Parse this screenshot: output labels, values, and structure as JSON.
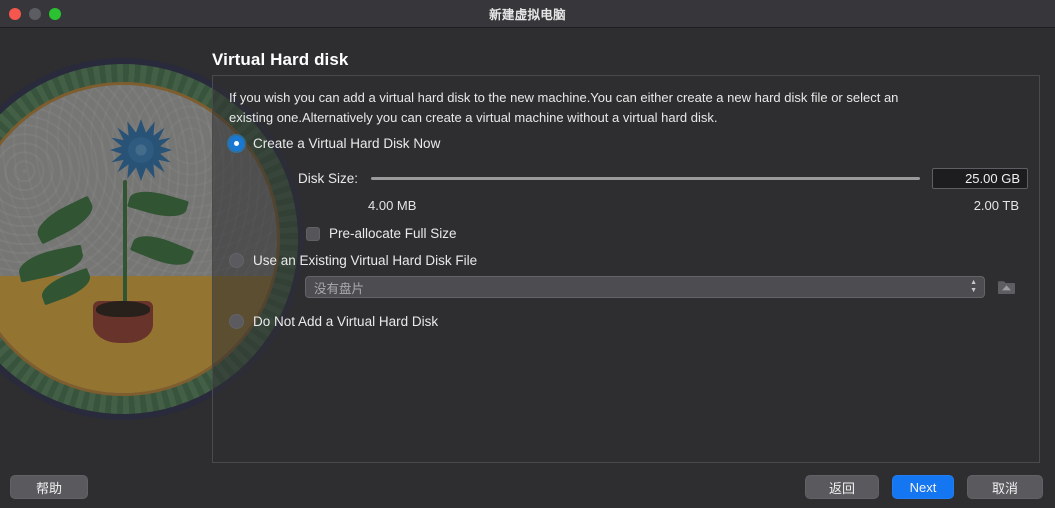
{
  "window": {
    "title": "新建虚拟电脑",
    "traffic_lights": [
      "close-button",
      "minimize-button",
      "maximize-button"
    ]
  },
  "page": {
    "title": "Virtual Hard disk",
    "description": "If you wish you can add a virtual hard disk to the new machine.You can either create a new hard disk file or select an existing one.Alternatively you can create a virtual machine without a virtual hard disk."
  },
  "options": {
    "create_now": {
      "label": "Create a Virtual Hard Disk Now",
      "selected": true
    },
    "use_existing": {
      "label": "Use an Existing Virtual Hard Disk File",
      "selected": false
    },
    "do_not_add": {
      "label": "Do Not Add a Virtual Hard Disk",
      "selected": false
    }
  },
  "disk_size": {
    "label": "Disk Size:",
    "value": "25.00 GB",
    "min": "4.00 MB",
    "max": "2.00 TB",
    "slider_position_percent": 1
  },
  "prealloc": {
    "label": "Pre-allocate Full Size",
    "checked": false
  },
  "existing_disk": {
    "selected_value": "没有盘片",
    "browse_icon": "folder-disk-icon"
  },
  "buttons": {
    "help": "帮助",
    "back": "返回",
    "next": "Next",
    "cancel": "取消"
  },
  "colors": {
    "accent": "#1576f2",
    "radio_on": "#1878d4",
    "window_bg": "#2e2e30",
    "titlebar_bg": "#37373b",
    "close": "#f5564d",
    "minimize": "#5c5c63",
    "maximize": "#2ac231"
  },
  "illustration": {
    "name": "potted-flower-medallion",
    "ring_navy": "#313552",
    "ring_green": "#5e8f62",
    "ring_ochre": "#c38a3a",
    "face_top": "#b5b5b3",
    "face_bottom": "#e7b23e",
    "flower": "#2f77b5",
    "stem": "#3f7a42",
    "pot": "#9e4233"
  }
}
